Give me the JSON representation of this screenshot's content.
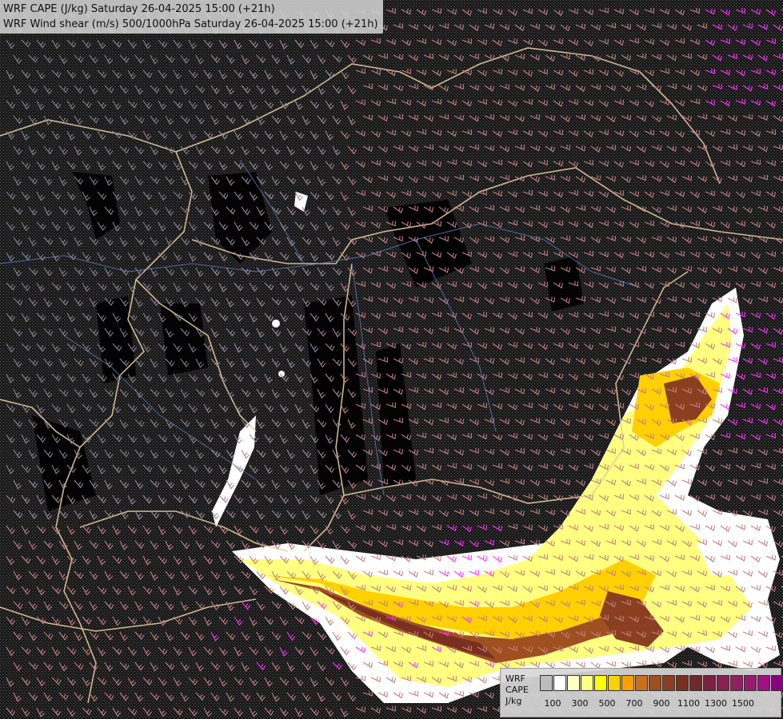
{
  "header": {
    "line1": "WRF CAPE (J/kg) Saturday 26-04-2025 15:00 (+21h)",
    "line2": "WRF Wind shear (m/s) 500/1000hPa Saturday 26-04-2025 15:00 (+21h)"
  },
  "legend": {
    "label1": "WRF",
    "label2": "CAPE",
    "label3": "J/kg",
    "swatches": [
      "#bdbdbd",
      "#ffffff",
      "#ffffc0",
      "#ffff80",
      "#ffff00",
      "#ffd000",
      "#ffa000",
      "#c87020",
      "#a05020",
      "#8a4020",
      "#7a3020",
      "#6e2a28",
      "#7a2040",
      "#882050",
      "#902060",
      "#9a1a70",
      "#a01080",
      "#880080"
    ],
    "ticks": [
      "100",
      "300",
      "500",
      "700",
      "900",
      "1100",
      "1300",
      "1500"
    ]
  },
  "colors": {
    "background": "#000000",
    "stipple": "#4a4a4a",
    "barb_west": "#9a8a9a",
    "barb_east": "#c08080",
    "barb_strong": "#ff33ff",
    "border": "#e6c9a0",
    "river": "#5a78c0"
  }
}
